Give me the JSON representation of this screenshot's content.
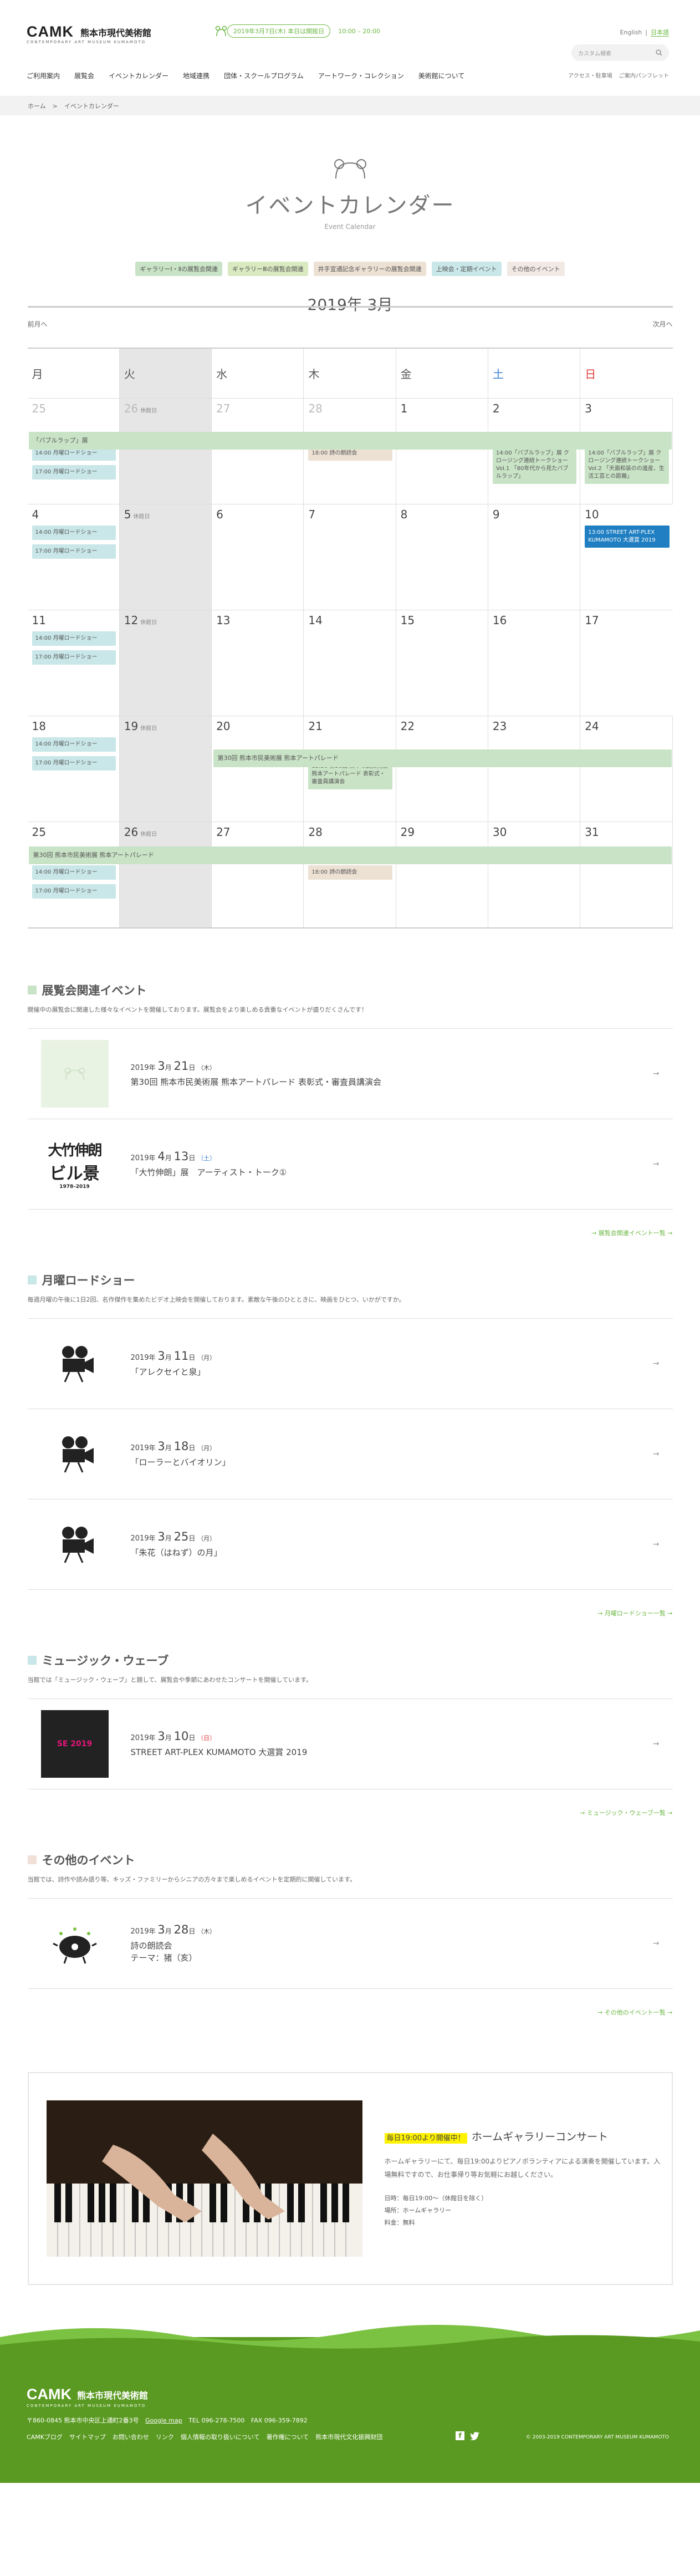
{
  "header": {
    "logo_main": "CAMK",
    "logo_jp": "熊本市現代美術館",
    "logo_sub": "CONTEMPORARY ART MUSEUM KUMAMOTO",
    "notice_date": "2019年3月7日(木) 本日は開館日",
    "notice_hours": "10:00 – 20:00",
    "lang_en": "English",
    "lang_jp": "日本語",
    "search_placeholder": "カスタム検索",
    "nav": [
      "展覧会",
      "イベントカレンダー",
      "地域連携",
      "団体・スクールプログラム",
      "アートワーク・コレクション",
      "美術館について"
    ],
    "nav_first": "ご利用案内",
    "subnav": [
      "アクセス・駐車場",
      "ご案内パンフレット"
    ]
  },
  "breadcrumb": {
    "home": "ホーム",
    "sep": ">",
    "current": "イベントカレンダー"
  },
  "hero": {
    "title": "イベントカレンダー",
    "subtitle": "Event Calendar"
  },
  "legend": [
    {
      "label": "ギャラリーⅠ・Ⅱの展覧会関連",
      "color": "#c9e3c6"
    },
    {
      "label": "ギャラリーⅢの展覧会関連",
      "color": "#d9e9c0"
    },
    {
      "label": "井手宣通記念ギャラリーの展覧会関連",
      "color": "#ede1d4"
    },
    {
      "label": "上映会・定期イベント",
      "color": "#c9e6e8"
    },
    {
      "label": "その他のイベント",
      "color": "#f2e9e4"
    }
  ],
  "calendar": {
    "month": "2019年 3月",
    "prev": "前月へ",
    "next": "次月へ",
    "weekdays": [
      "月",
      "火",
      "水",
      "木",
      "金",
      "土",
      "日"
    ],
    "closed": "休館日",
    "weeks": [
      {
        "days": [
          "25",
          "26",
          "27",
          "28",
          "1",
          "2",
          "3"
        ],
        "bar": "「バブルラップ」展",
        "events": {
          "mon": [
            "14:00 月曜ロードショー",
            "17:00 月曜ロードショー"
          ],
          "thu": [
            "18:00 詩の朗読会"
          ],
          "sat": [
            "14:00「バブルラップ」展 クロージング連続トークショー Vol.1 「80年代から見たバブルラップ」"
          ],
          "sun": [
            "14:00「バブルラップ」展 クロージング連続トークショー Vol.2 「天面和装のの遺産、生活工芸との距離」"
          ]
        }
      },
      {
        "days": [
          "4",
          "5",
          "6",
          "7",
          "8",
          "9",
          "10"
        ],
        "events": {
          "mon": [
            "14:00 月曜ロードショー",
            "17:00 月曜ロードショー"
          ],
          "sun": [
            "13:00 STREET ART-PLEX KUMAMOTO 大選賞 2019"
          ]
        }
      },
      {
        "days": [
          "11",
          "12",
          "13",
          "14",
          "15",
          "16",
          "17"
        ],
        "events": {
          "mon": [
            "14:00 月曜ロードショー",
            "17:00 月曜ロードショー"
          ]
        }
      },
      {
        "days": [
          "18",
          "19",
          "20",
          "21",
          "22",
          "23",
          "24"
        ],
        "bar": "第30回 熊本市民美術展 熊本アートパレード",
        "events": {
          "mon": [
            "14:00 月曜ロードショー",
            "17:00 月曜ロードショー"
          ],
          "thu": [
            "13:30 第30回 熊本市民美術展 熊本アートパレード 表彰式・審査員講演会"
          ]
        }
      },
      {
        "days": [
          "25",
          "26",
          "27",
          "28",
          "29",
          "30",
          "31"
        ],
        "bar": "第30回 熊本市民美術展 熊本アートパレード",
        "events": {
          "mon": [
            "14:00 月曜ロードショー",
            "17:00 月曜ロードショー"
          ],
          "thu": [
            "18:00 詩の朗読会"
          ]
        }
      }
    ]
  },
  "sections": [
    {
      "title": "展覧会関連イベント",
      "color": "#c9e3c6",
      "desc": "開催中の展覧会に関連した様々なイベントを開催しております。展覧会をより楽しめる貴重なイベントが盛りだくさんです！",
      "items": [
        {
          "year": "2019",
          "m": "3",
          "d": "21",
          "wd": "（木）",
          "title": "第30回 熊本市民美術展 熊本アートパレード 表彰式・審査員講演会"
        },
        {
          "year": "2019",
          "m": "4",
          "d": "13",
          "wd": "（土）",
          "title": "「大竹伸朗」展　アーティスト・トーク①"
        }
      ],
      "more": "→ 展覧会関連イベント一覧 →"
    },
    {
      "title": "月曜ロードショー",
      "color": "#c9e6e8",
      "desc": "毎週月曜の午後に1日2回、名作傑作を集めたビデオ上映会を開催しております。素敵な午後のひとときに、映画をひとつ、いかがですか。",
      "items": [
        {
          "year": "2019",
          "m": "3",
          "d": "11",
          "wd": "（月）",
          "title": "「アレクセイと泉」"
        },
        {
          "year": "2019",
          "m": "3",
          "d": "18",
          "wd": "（月）",
          "title": "「ローラーとバイオリン」"
        },
        {
          "year": "2019",
          "m": "3",
          "d": "25",
          "wd": "（月）",
          "title": "「朱花（はねず）の月」"
        }
      ],
      "more": "→ 月曜ロードショー一覧 →"
    },
    {
      "title": "ミュージック・ウェーブ",
      "color": "#c9e6e8",
      "desc": "当館では「ミュージック・ウェーブ」と題して、展覧会や季節にあわせたコンサートを開催しています。",
      "items": [
        {
          "year": "2019",
          "m": "3",
          "d": "10",
          "wd": "（日）",
          "title": "STREET ART-PLEX KUMAMOTO 大選賞 2019"
        }
      ],
      "more": "→ ミュージック・ウェーブ一覧 →"
    },
    {
      "title": "その他のイベント",
      "color": "#f2e0d8",
      "desc": "当館では、詩作や読み語り等、キッズ・ファミリーからシニアの方々まで楽しめるイベントを定期的に開催しています。",
      "items": [
        {
          "year": "2019",
          "m": "3",
          "d": "28",
          "wd": "（木）",
          "title": "詩の朗読会",
          "title2": "テーマ：猪（亥）"
        }
      ],
      "more": "→ その他のイベント一覧 →"
    }
  ],
  "thumb_text": {
    "otake_a": "大竹伸朗",
    "otake_b": "ビル景",
    "otake_c": "1978–2019",
    "street": "SE 2019"
  },
  "concert": {
    "highlight": "毎日19:00より開催中！",
    "title": "ホームギャラリーコンサート",
    "desc": "ホームギャラリーにて、毎日19:00よりピアノボランティアによる演奏を開催しています。入場無料ですので、お仕事帰り等お気軽にお越しください。",
    "date": "日時：毎日19:00～（休館日を除く）",
    "place": "場所：ホームギャラリー",
    "fee": "料金：無料"
  },
  "footer": {
    "logo_main": "CAMK",
    "logo_jp": "熊本市現代美術館",
    "logo_sub": "CONTEMPORARY ART MUSEUM KUMAMOTO",
    "address": "〒860-0845 熊本市中央区上通町2番3号",
    "map": "Google map",
    "tel": "TEL 096-278-7500",
    "fax": "FAX 096-359-7892",
    "links": [
      "CAMKブログ",
      "サイトマップ",
      "お問い合わせ",
      "リンク",
      "個人情報の取り扱いについて",
      "著作権について",
      "熊本市現代文化振興財団"
    ],
    "copyright": "© 2003-2019 CONTEMPORARY ART MUSEUM KUMAMOTO"
  }
}
